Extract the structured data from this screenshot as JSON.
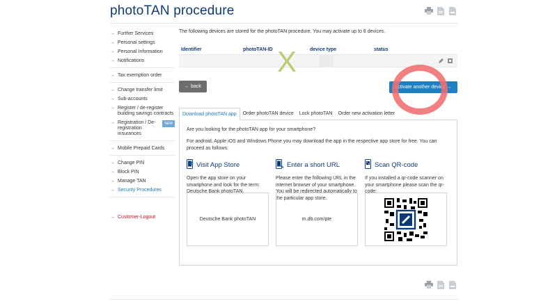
{
  "page": {
    "title": "photoTAN procedure"
  },
  "sidebar": {
    "group1": [
      {
        "label": "Further Services"
      },
      {
        "label": "Personal settings"
      },
      {
        "label": "Personal Information"
      },
      {
        "label": "Notifications"
      }
    ],
    "group2": [
      {
        "label": "Tax exemption order"
      }
    ],
    "group3": [
      {
        "label": "Change transfer limit"
      },
      {
        "label": "Sub-accounts"
      },
      {
        "label": "Register / de-register building savings contracts"
      },
      {
        "label": "Registration / De-registration insurances",
        "badge": "NEW"
      }
    ],
    "group4": [
      {
        "label": "Mobile Prepaid Cards"
      }
    ],
    "group5": [
      {
        "label": "Change PIN"
      },
      {
        "label": "Block PIN"
      },
      {
        "label": "Manage TAN"
      },
      {
        "label": "Security Procedures"
      }
    ],
    "logout": "Customer-Logout"
  },
  "main": {
    "intro": "The following devices are stored for the photoTAN procedure. You may activate up to 8 devices.",
    "table": {
      "headers": [
        "Identifier",
        "photoTAN-ID",
        "device type",
        "status"
      ]
    },
    "buttons": {
      "back": "back",
      "activate": "activate another device"
    },
    "tabs": [
      {
        "label": "Download photoTAN app"
      },
      {
        "label": "Order photoTAN device"
      },
      {
        "label": "Lock photoTAN"
      },
      {
        "label": "Order new activation letter"
      }
    ],
    "panel": {
      "question": "Are you looking for the photoTAN app for your smartphone?",
      "paragraph": "For android, Apple iOS and Windows Phone you may download the app in the respective app store for free. You can proceed as follows:",
      "columns": [
        {
          "title": "Visit App Store",
          "desc": "Open the app store on your smartphone and look for the term: Deutsche Bank photoTAN.",
          "box": "Deutsche Bank photoTAN"
        },
        {
          "title": "Enter a short URL",
          "desc": "Please enter the following URL in the internet browser of your smartphone. You will be redirected automatically to the particular app store.",
          "box": "m.db.com/pte"
        },
        {
          "title": "Scan QR-code",
          "desc": "If you installed a qr-code scanner on your smartphone please scan the qr-code:",
          "box": ""
        }
      ]
    }
  },
  "overlay": {
    "mark": "X"
  },
  "colors": {
    "brand": "#0e3b77",
    "accent": "#1e7fc4",
    "back": "#6d6d6d",
    "logout": "#c8102e"
  }
}
